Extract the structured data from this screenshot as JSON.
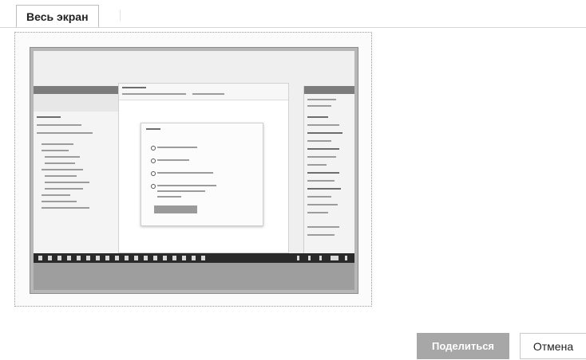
{
  "tabs": [
    {
      "label": "Весь экран",
      "selected": true
    }
  ],
  "preview": {
    "description_icon": "screen-preview-thumbnail"
  },
  "actions": {
    "share_label": "Поделиться",
    "cancel_label": "Отмена"
  },
  "colors": {
    "share_button_bg": "#a7a7a7",
    "cancel_button_bg": "#ffffff",
    "tab_border": "#bdbdbd"
  }
}
